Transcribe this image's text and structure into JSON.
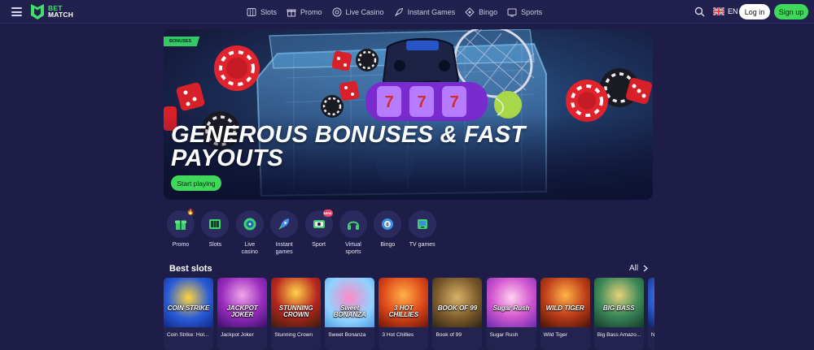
{
  "header": {
    "logo_top": "BET",
    "logo_bottom": "MATCH",
    "nav": [
      {
        "label": "Slots",
        "icon": "slots-icon"
      },
      {
        "label": "Promo",
        "icon": "gift-icon"
      },
      {
        "label": "Live Casino",
        "icon": "roulette-icon"
      },
      {
        "label": "Instant Games",
        "icon": "rocket-icon"
      },
      {
        "label": "Bingo",
        "icon": "bingo-icon"
      },
      {
        "label": "Sports",
        "icon": "tv-icon"
      }
    ],
    "lang": "EN",
    "login_label": "Log in",
    "signup_label": "Sign up"
  },
  "banner": {
    "badge": "BONUSES",
    "headline": "GENEROUS BONUSES & FAST PAYOUTS",
    "cta_label": "Start playing"
  },
  "categories": [
    {
      "label": "Promo",
      "icon": "gift-icon",
      "marker": "🔥"
    },
    {
      "label": "Slots",
      "icon": "slots-icon"
    },
    {
      "label": "Live casino",
      "icon": "roulette-icon"
    },
    {
      "label": "Instant games",
      "icon": "rocket-icon"
    },
    {
      "label": "Sport",
      "icon": "tv-icon",
      "marker": "NEW"
    },
    {
      "label": "Virtual sports",
      "icon": "headset-icon"
    },
    {
      "label": "Bingo",
      "icon": "bingo-icon"
    },
    {
      "label": "TV games",
      "icon": "tv-games-icon"
    }
  ],
  "best_slots": {
    "title": "Best slots",
    "all_label": "All",
    "games": [
      {
        "name": "Coin Strike: Hol...",
        "art": "COIN STRIKE"
      },
      {
        "name": "Jackpot Joker",
        "art": "JACKPOT JOKER"
      },
      {
        "name": "Stunning Crown",
        "art": "STUNNING CROWN"
      },
      {
        "name": "Sweet Bonanza",
        "art": "Sweet BONANZA"
      },
      {
        "name": "3 Hot Chillies",
        "art": "3 HOT CHILLIES"
      },
      {
        "name": "Book of 99",
        "art": "BOOK OF 99"
      },
      {
        "name": "Sugar Rush",
        "art": "Sugar Rush"
      },
      {
        "name": "Wild Tiger",
        "art": "WILD TIGER"
      },
      {
        "name": "Big Bass Amazo...",
        "art": "BIG BASS"
      },
      {
        "name": "N",
        "art": ""
      }
    ]
  },
  "colors": {
    "background": "#1e1d47",
    "accent": "#3fd85a",
    "card": "#24234f"
  }
}
